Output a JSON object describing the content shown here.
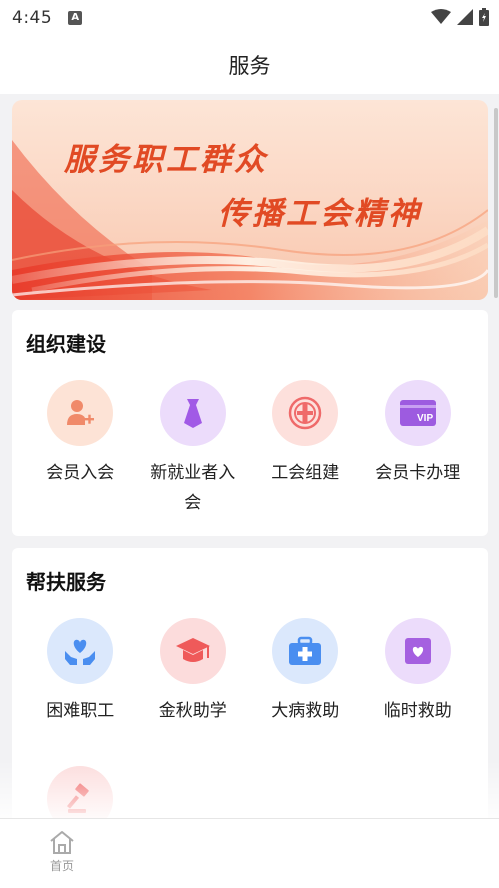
{
  "status_bar": {
    "time": "4:45",
    "notification_icon": "a-box-icon",
    "wifi_icon": "wifi-icon",
    "signal_icon": "signal-icon",
    "battery_icon": "battery-icon"
  },
  "header": {
    "title": "服务"
  },
  "banner": {
    "line1": "服务职工群众",
    "line2": "传播工会精神"
  },
  "org_section": {
    "title": "组织建设",
    "items": [
      {
        "label": "会员入会",
        "icon": "user-add-icon",
        "color": "#f08a6a"
      },
      {
        "label": "新就业者入会",
        "icon": "tie-icon",
        "color": "#a15ae6"
      },
      {
        "label": "工会组建",
        "icon": "union-emblem-icon",
        "color": "#ef6a6a"
      },
      {
        "label": "会员卡办理",
        "icon": "vip-card-icon",
        "color": "#9d5be0"
      }
    ]
  },
  "help_section": {
    "title": "帮扶服务",
    "items": [
      {
        "label": "困难职工",
        "icon": "heart-hands-icon",
        "color": "#4a8ef0"
      },
      {
        "label": "金秋助学",
        "icon": "graduation-cap-icon",
        "color": "#ef5a5a"
      },
      {
        "label": "大病救助",
        "icon": "medical-kit-icon",
        "color": "#4a8ef0"
      },
      {
        "label": "临时救助",
        "icon": "heart-box-icon",
        "color": "#a560e0"
      },
      {
        "label": "",
        "icon": "gavel-icon",
        "color": "#ef5a5a"
      }
    ]
  },
  "bottom_nav": {
    "home_label": "首页",
    "home_icon": "home-icon"
  }
}
